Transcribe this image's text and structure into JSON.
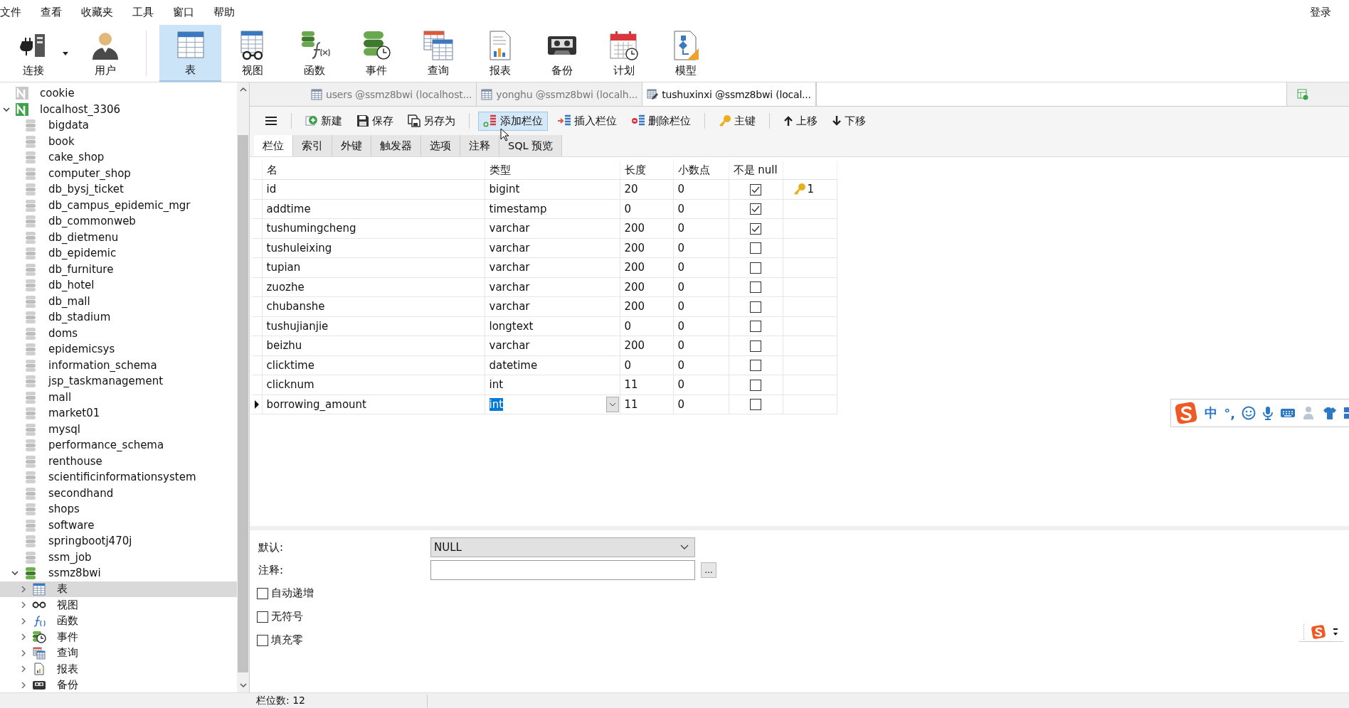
{
  "menu": [
    {
      "label": "文件"
    },
    {
      "label": "查看"
    },
    {
      "label": "收藏夹"
    },
    {
      "label": "工具"
    },
    {
      "label": "窗口"
    },
    {
      "label": "帮助"
    }
  ],
  "login": "登录",
  "toolbar": [
    {
      "label": "连接",
      "kind": "connection",
      "selected": false
    },
    {
      "label": "用户",
      "kind": "user",
      "selected": false
    },
    {
      "label": "表",
      "kind": "table",
      "selected": true
    },
    {
      "label": "视图",
      "kind": "view",
      "selected": false
    },
    {
      "label": "函数",
      "kind": "function",
      "selected": false
    },
    {
      "label": "事件",
      "kind": "event",
      "selected": false
    },
    {
      "label": "查询",
      "kind": "query",
      "selected": false
    },
    {
      "label": "报表",
      "kind": "report",
      "selected": false
    },
    {
      "label": "备份",
      "kind": "backup",
      "selected": false
    },
    {
      "label": "计划",
      "kind": "schedule",
      "selected": false
    },
    {
      "label": "模型",
      "kind": "model",
      "selected": false
    }
  ],
  "sidebar": {
    "items": [
      {
        "label": "cookie",
        "kind": "connection_off",
        "selected": false
      },
      {
        "label": "localhost_3306",
        "kind": "connection_on",
        "selected": false,
        "expanded": true,
        "children": [
          {
            "label": "bigdata",
            "kind": "database",
            "selected": false
          },
          {
            "label": "book",
            "kind": "database",
            "selected": false
          },
          {
            "label": "cake_shop",
            "kind": "database",
            "selected": false
          },
          {
            "label": "computer_shop",
            "kind": "database",
            "selected": false
          },
          {
            "label": "db_bysj_ticket",
            "kind": "database",
            "selected": false
          },
          {
            "label": "db_campus_epidemic_mgr",
            "kind": "database",
            "selected": false
          },
          {
            "label": "db_commonweb",
            "kind": "database",
            "selected": false
          },
          {
            "label": "db_dietmenu",
            "kind": "database",
            "selected": false
          },
          {
            "label": "db_epidemic",
            "kind": "database",
            "selected": false
          },
          {
            "label": "db_furniture",
            "kind": "database",
            "selected": false
          },
          {
            "label": "db_hotel",
            "kind": "database",
            "selected": false
          },
          {
            "label": "db_mall",
            "kind": "database",
            "selected": false
          },
          {
            "label": "db_stadium",
            "kind": "database",
            "selected": false
          },
          {
            "label": "doms",
            "kind": "database",
            "selected": false
          },
          {
            "label": "epidemicsys",
            "kind": "database",
            "selected": false
          },
          {
            "label": "information_schema",
            "kind": "database",
            "selected": false
          },
          {
            "label": "jsp_taskmanagement",
            "kind": "database",
            "selected": false
          },
          {
            "label": "mall",
            "kind": "database",
            "selected": false
          },
          {
            "label": "market01",
            "kind": "database",
            "selected": false
          },
          {
            "label": "mysql",
            "kind": "database",
            "selected": false
          },
          {
            "label": "performance_schema",
            "kind": "database",
            "selected": false
          },
          {
            "label": "renthouse",
            "kind": "database",
            "selected": false
          },
          {
            "label": "scientificinformationsystem",
            "kind": "database",
            "selected": false
          },
          {
            "label": "secondhand",
            "kind": "database",
            "selected": false
          },
          {
            "label": "shops",
            "kind": "database",
            "selected": false
          },
          {
            "label": "software",
            "kind": "database",
            "selected": false
          },
          {
            "label": "springbootj470j",
            "kind": "database",
            "selected": false
          },
          {
            "label": "ssm_job",
            "kind": "database",
            "selected": false
          },
          {
            "label": "ssmz8bwi",
            "kind": "database_open",
            "selected": false,
            "expanded": true,
            "children": [
              {
                "label": "表",
                "kind": "tables",
                "selected": true,
                "expanded": false
              },
              {
                "label": "视图",
                "kind": "views",
                "selected": false,
                "expanded": false
              },
              {
                "label": "函数",
                "kind": "functions",
                "selected": false,
                "expanded": false
              },
              {
                "label": "事件",
                "kind": "events",
                "selected": false,
                "expanded": false
              },
              {
                "label": "查询",
                "kind": "queries",
                "selected": false,
                "expanded": false
              },
              {
                "label": "报表",
                "kind": "reports",
                "selected": false,
                "expanded": false
              },
              {
                "label": "备份",
                "kind": "backups",
                "selected": false,
                "expanded": false
              }
            ]
          }
        ]
      }
    ]
  },
  "tabs": [
    {
      "label": "users @ssmz8bwi (localhost...",
      "kind": "table",
      "selected": false
    },
    {
      "label": "yonghu @ssmz8bwi (localh...",
      "kind": "table",
      "selected": false
    },
    {
      "label": "tushuxinxi @ssmz8bwi (local...",
      "kind": "design",
      "selected": true
    }
  ],
  "editor_toolbar": [
    {
      "kind": "menu"
    },
    {
      "label": "新建",
      "kind": "new",
      "hovered": false
    },
    {
      "label": "保存",
      "kind": "save",
      "hovered": false
    },
    {
      "label": "另存为",
      "kind": "save_as",
      "hovered": false
    },
    {
      "label": "添加栏位",
      "kind": "add_field",
      "hovered": true
    },
    {
      "label": "插入栏位",
      "kind": "insert_field",
      "hovered": false
    },
    {
      "label": "删除栏位",
      "kind": "delete_field",
      "hovered": false
    },
    {
      "label": "主键",
      "kind": "primary_key",
      "hovered": false
    },
    {
      "label": "上移",
      "kind": "move_up",
      "hovered": false
    },
    {
      "label": "下移",
      "kind": "move_down",
      "hovered": false
    }
  ],
  "subtabs": [
    {
      "label": "栏位",
      "selected": true
    },
    {
      "label": "索引",
      "selected": false
    },
    {
      "label": "外键",
      "selected": false
    },
    {
      "label": "触发器",
      "selected": false
    },
    {
      "label": "选项",
      "selected": false
    },
    {
      "label": "注释",
      "selected": false
    },
    {
      "label": "SQL 预览",
      "selected": false
    }
  ],
  "table": {
    "columns": [
      "名",
      "类型",
      "长度",
      "小数点",
      "不是 null"
    ],
    "rows": [
      {
        "name": "id",
        "type": "bigint",
        "length": "20",
        "decimals": "0",
        "not_null": true,
        "key": "1",
        "selected": false
      },
      {
        "name": "addtime",
        "type": "timestamp",
        "length": "0",
        "decimals": "0",
        "not_null": true,
        "selected": false
      },
      {
        "name": "tushumingcheng",
        "type": "varchar",
        "length": "200",
        "decimals": "0",
        "not_null": true,
        "selected": false
      },
      {
        "name": "tushuleixing",
        "type": "varchar",
        "length": "200",
        "decimals": "0",
        "not_null": false,
        "selected": false
      },
      {
        "name": "tupian",
        "type": "varchar",
        "length": "200",
        "decimals": "0",
        "not_null": false,
        "selected": false
      },
      {
        "name": "zuozhe",
        "type": "varchar",
        "length": "200",
        "decimals": "0",
        "not_null": false,
        "selected": false
      },
      {
        "name": "chubanshe",
        "type": "varchar",
        "length": "200",
        "decimals": "0",
        "not_null": false,
        "selected": false
      },
      {
        "name": "tushujianjie",
        "type": "longtext",
        "length": "0",
        "decimals": "0",
        "not_null": false,
        "selected": false
      },
      {
        "name": "beizhu",
        "type": "varchar",
        "length": "200",
        "decimals": "0",
        "not_null": false,
        "selected": false
      },
      {
        "name": "clicktime",
        "type": "datetime",
        "length": "0",
        "decimals": "0",
        "not_null": false,
        "selected": false
      },
      {
        "name": "clicknum",
        "type": "int",
        "length": "11",
        "decimals": "0",
        "not_null": false,
        "selected": false
      },
      {
        "name": "borrowing_amount",
        "type": "int",
        "length": "11",
        "decimals": "0",
        "not_null": false,
        "selected": true
      }
    ]
  },
  "properties": {
    "default_label": "默认:",
    "default_value": "NULL",
    "comment_label": "注释:",
    "more_button": "...",
    "options": [
      {
        "label": "自动递增",
        "checked": false
      },
      {
        "label": "无符号",
        "checked": false
      },
      {
        "label": "填充零",
        "checked": false
      }
    ]
  },
  "status_bar": "栏位数: 12",
  "ime_bar": {
    "mode": "中",
    "punctuation": "°,"
  }
}
